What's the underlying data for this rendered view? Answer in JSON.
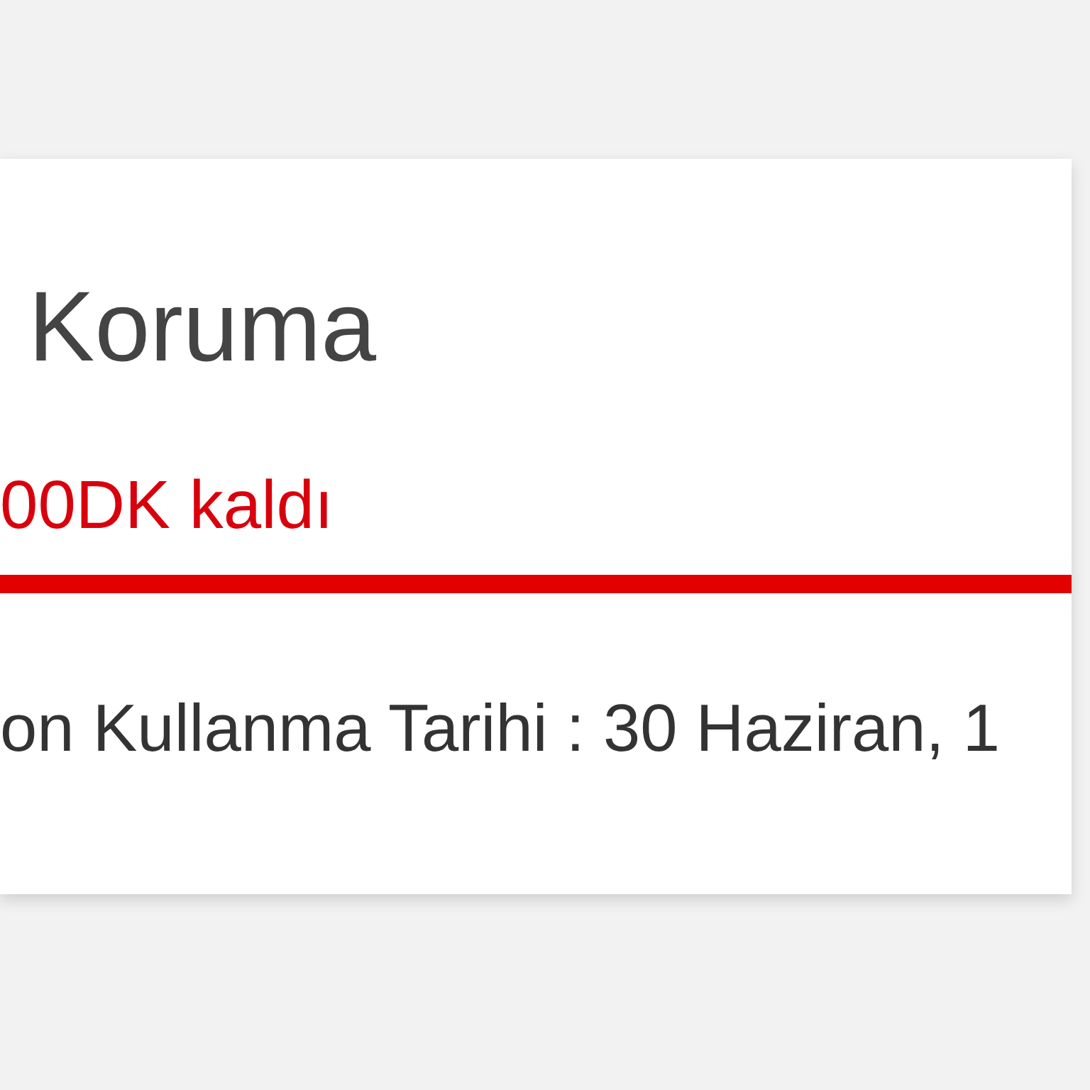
{
  "card": {
    "title": "Koruma",
    "remaining": "00DK kaldı",
    "usage": {
      "level": 1
    },
    "expiry": "on Kullanma Tarihi : 30 Haziran, 1"
  }
}
